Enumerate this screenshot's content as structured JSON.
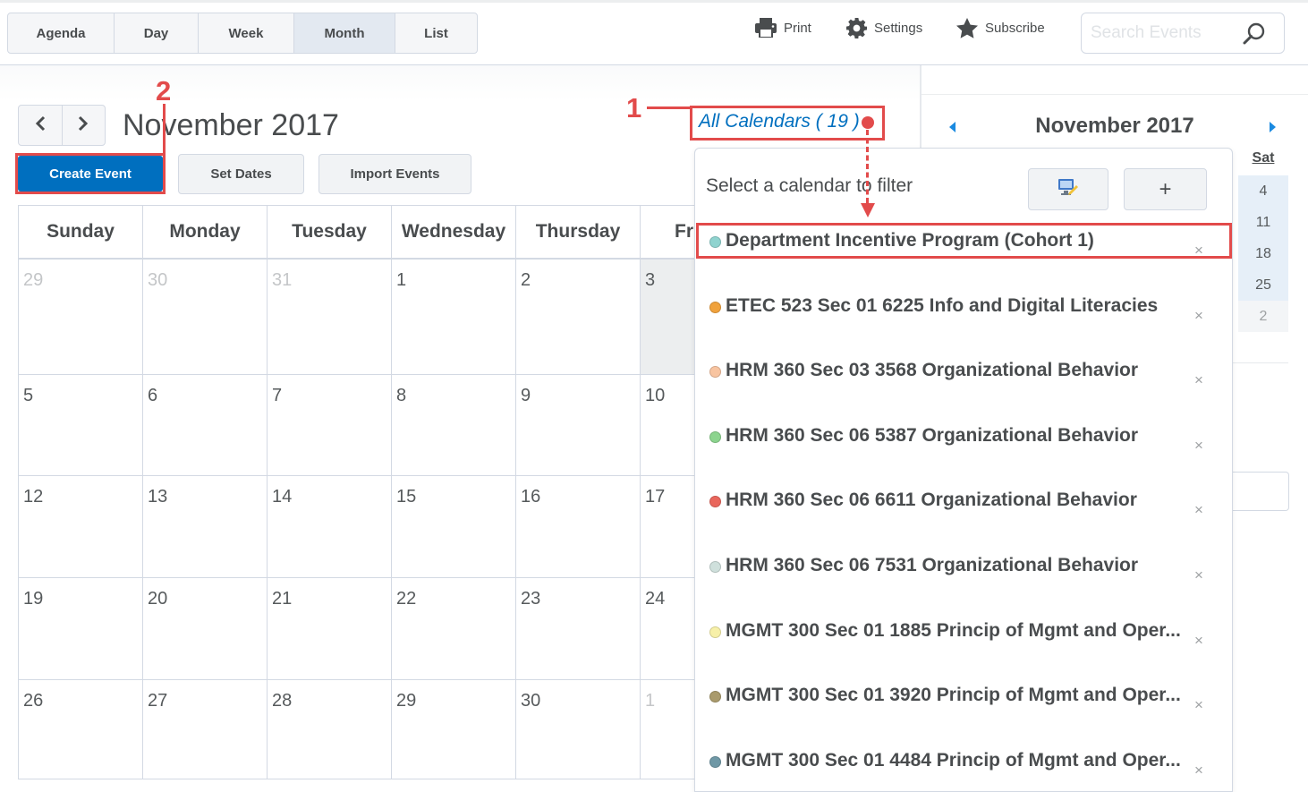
{
  "view_tabs": [
    "Agenda",
    "Day",
    "Week",
    "Month",
    "List"
  ],
  "active_view": "Month",
  "toolbar": {
    "print": "Print",
    "settings": "Settings",
    "subscribe": "Subscribe"
  },
  "search": {
    "placeholder": "Search Events",
    "value": ""
  },
  "month_title": "November 2017",
  "buttons": {
    "create": "Create Event",
    "set_dates": "Set Dates",
    "import": "Import Events"
  },
  "all_calendars": "All Calendars ( 19 )",
  "weekdays": [
    "Sunday",
    "Monday",
    "Tuesday",
    "Wednesday",
    "Thursday",
    "Fri"
  ],
  "weeks": [
    [
      "29",
      "30",
      "31",
      "1",
      "2",
      "3"
    ],
    [
      "5",
      "6",
      "7",
      "8",
      "9",
      "10"
    ],
    [
      "12",
      "13",
      "14",
      "15",
      "16",
      "17"
    ],
    [
      "19",
      "20",
      "21",
      "22",
      "23",
      "24"
    ],
    [
      "26",
      "27",
      "28",
      "29",
      "30",
      "1"
    ]
  ],
  "mini_calendar": {
    "title": "November 2017",
    "sat_header": "Sat",
    "sat_dates": [
      "4",
      "11",
      "18",
      "25",
      "2"
    ]
  },
  "filter": {
    "title": "Select a calendar to filter",
    "add": "+",
    "remove": "×",
    "calendars": [
      {
        "name": "Department Incentive Program (Cohort 1)",
        "color": "#8fd3cf"
      },
      {
        "name": "ETEC 523 Sec 01 6225 Info and Digital Literacies",
        "color": "#f0a23c"
      },
      {
        "name": "HRM 360 Sec 03 3568 Organizational Behavior",
        "color": "#f8c4a0"
      },
      {
        "name": "HRM 360 Sec 06 5387 Organizational Behavior",
        "color": "#8cd48e"
      },
      {
        "name": "HRM 360 Sec 06 6611 Organizational Behavior",
        "color": "#e9665c"
      },
      {
        "name": "HRM 360 Sec 06 7531 Organizational Behavior",
        "color": "#cfe0dc"
      },
      {
        "name": "MGMT 300 Sec 01 1885 Princip of Mgmt and Oper...",
        "color": "#f7f0a8"
      },
      {
        "name": "MGMT 300 Sec 01 3920 Princip of Mgmt and Oper...",
        "color": "#a99a6c"
      },
      {
        "name": "MGMT 300 Sec 01 4484 Princip of Mgmt and Oper...",
        "color": "#6f98a6"
      }
    ]
  },
  "callouts": [
    "1",
    "2"
  ]
}
